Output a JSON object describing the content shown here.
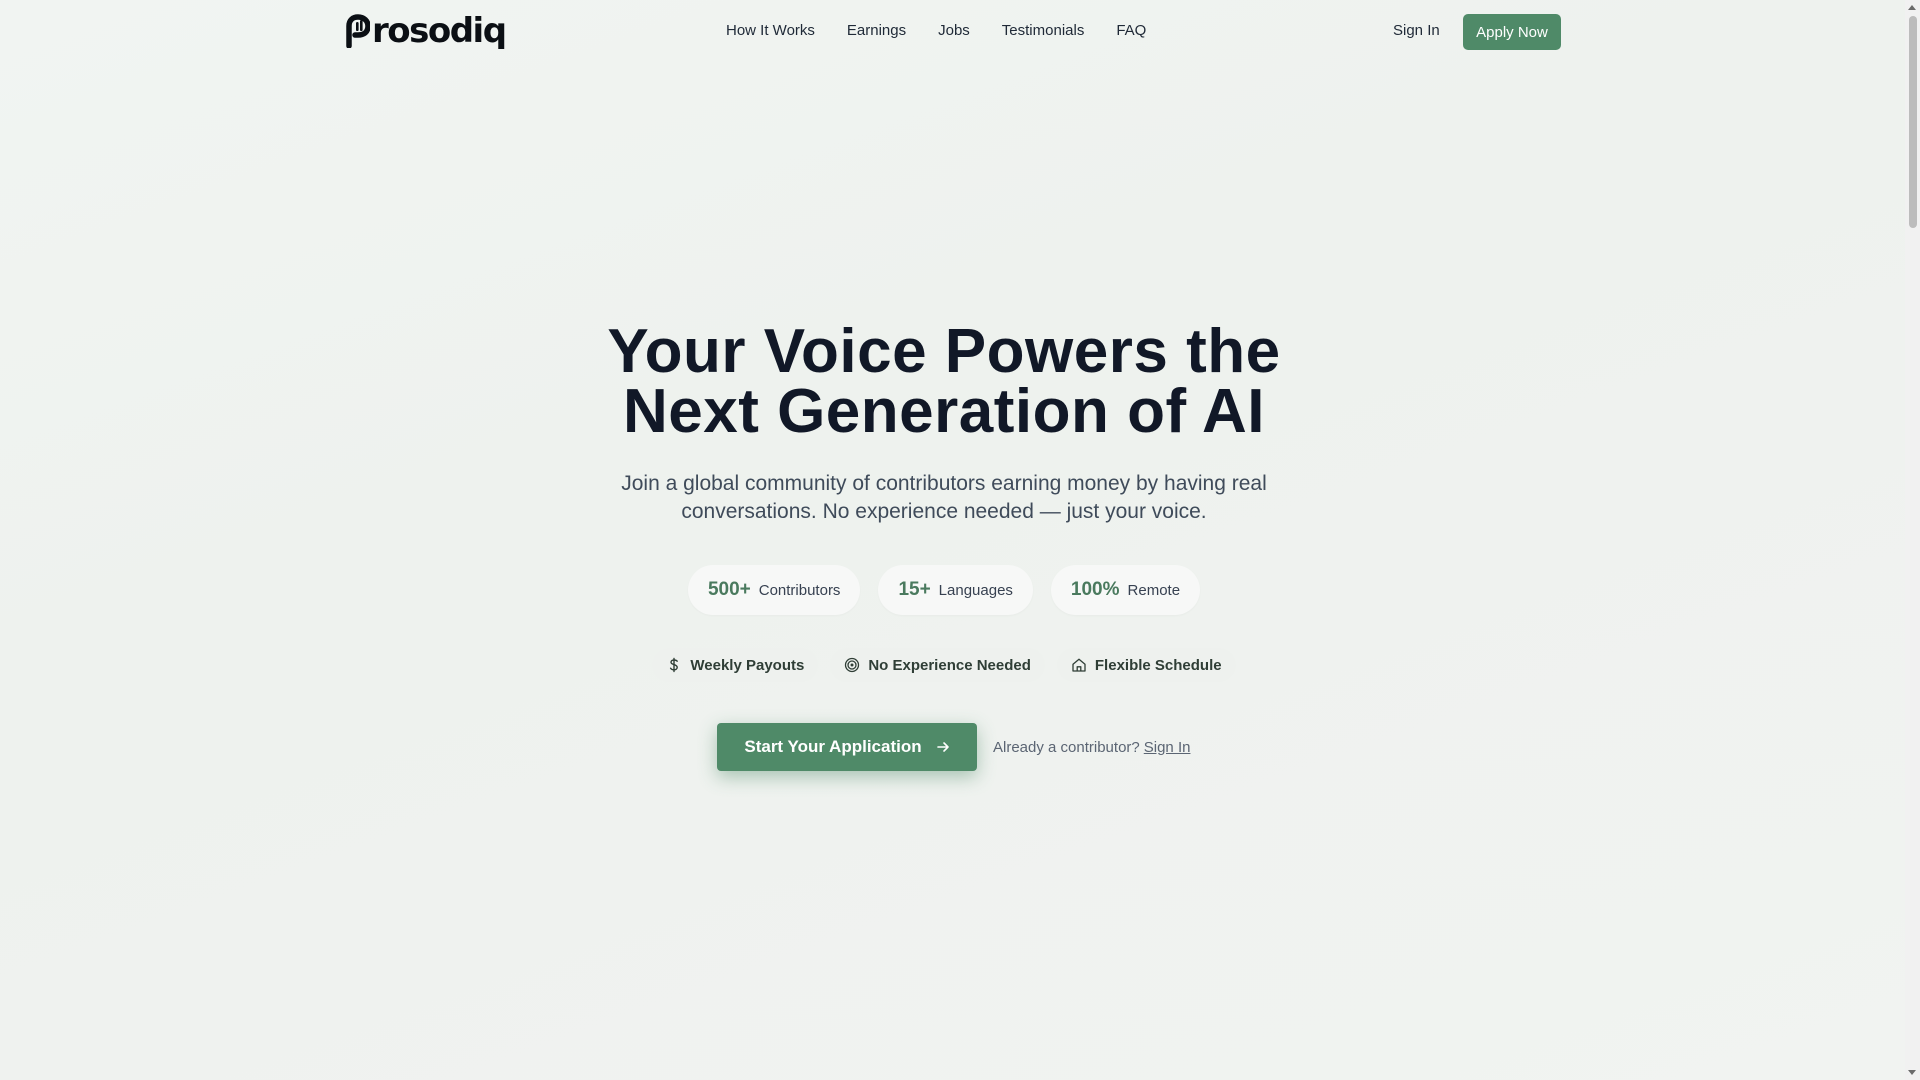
{
  "brand": {
    "name": "Prosodiq",
    "logo_text": "rosodiq",
    "accent_color": "#4f8a68"
  },
  "nav": {
    "links": [
      {
        "label": "How It Works"
      },
      {
        "label": "Earnings"
      },
      {
        "label": "Jobs"
      },
      {
        "label": "Testimonials"
      },
      {
        "label": "FAQ"
      }
    ],
    "sign_in_label": "Sign In",
    "apply_label": "Apply Now"
  },
  "hero": {
    "title_line1": "Your Voice Powers the",
    "title_line2": "Next Generation of AI",
    "subtitle_line1": "Join a global community of contributors earning money by having real",
    "subtitle_line2": "conversations. No experience needed — just your voice."
  },
  "stats": [
    {
      "value": "500+",
      "label": "Contributors"
    },
    {
      "value": "15+",
      "label": "Languages"
    },
    {
      "value": "100%",
      "label": "Remote"
    }
  ],
  "features": [
    {
      "icon": "dollar-icon",
      "label": "Weekly Payouts"
    },
    {
      "icon": "target-icon",
      "label": "No Experience Needed"
    },
    {
      "icon": "home-icon",
      "label": "Flexible Schedule"
    }
  ],
  "cta": {
    "button_label": "Start Your Application",
    "already_text": "Already a contributor?",
    "sign_in_link": "Sign In"
  }
}
